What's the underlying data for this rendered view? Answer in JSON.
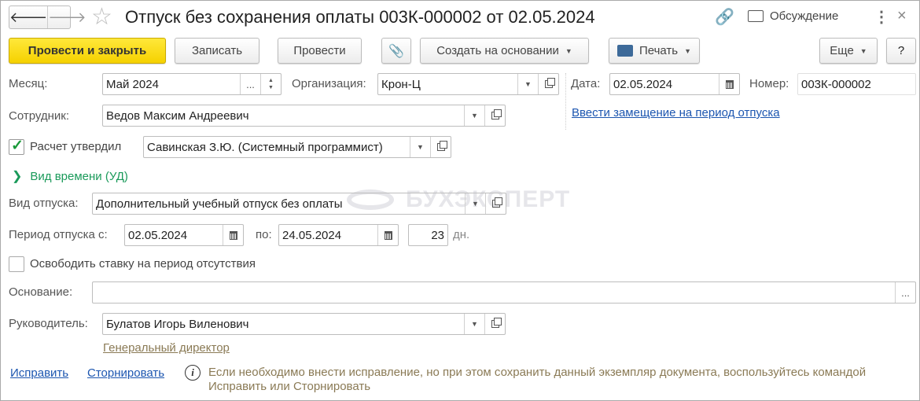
{
  "header": {
    "title": "Отпуск без сохранения оплаты 003К-000002 от 02.05.2024",
    "discussion": "Обсуждение"
  },
  "toolbar": {
    "post_close": "Провести и закрыть",
    "save": "Записать",
    "post": "Провести",
    "create_based": "Создать на основании",
    "print": "Печать",
    "more": "Еще",
    "help": "?"
  },
  "form": {
    "month_label": "Месяц:",
    "month": "Май 2024",
    "month_pick": "...",
    "org_label": "Организация:",
    "org": "Крон-Ц",
    "date_label": "Дата:",
    "date": "02.05.2024",
    "number_label": "Номер:",
    "number": "003К-000002",
    "replacement_link": "Ввести замещение на период отпуска",
    "employee_label": "Сотрудник:",
    "employee": "Ведов Максим Андреевич",
    "approved_label": "Расчет утвердил",
    "approved_checked": true,
    "approved_by": "Савинская З.Ю. (Системный программист)",
    "time_type": "Вид времени (УД)",
    "leave_type_label": "Вид отпуска:",
    "leave_type": "Дополнительный учебный отпуск без оплаты",
    "period_label": "Период отпуска с:",
    "period_from": "02.05.2024",
    "period_to_label": "по:",
    "period_to": "24.05.2024",
    "days": "23",
    "days_unit": "дн.",
    "free_rate_label": "Освободить ставку на период отсутствия",
    "free_rate_checked": false,
    "basis_label": "Основание:",
    "basis": "",
    "basis_pick": "...",
    "manager_label": "Руководитель:",
    "manager": "Булатов Игорь Виленович",
    "manager_position": "Генеральный директор"
  },
  "footer": {
    "fix": "Исправить",
    "storno": "Сторнировать",
    "info": "Если необходимо внести исправление, но при этом сохранить данный экземпляр документа, воспользуйтесь командой Исправить или Сторнировать"
  },
  "watermark": "БУХЭКСПЕРТ"
}
